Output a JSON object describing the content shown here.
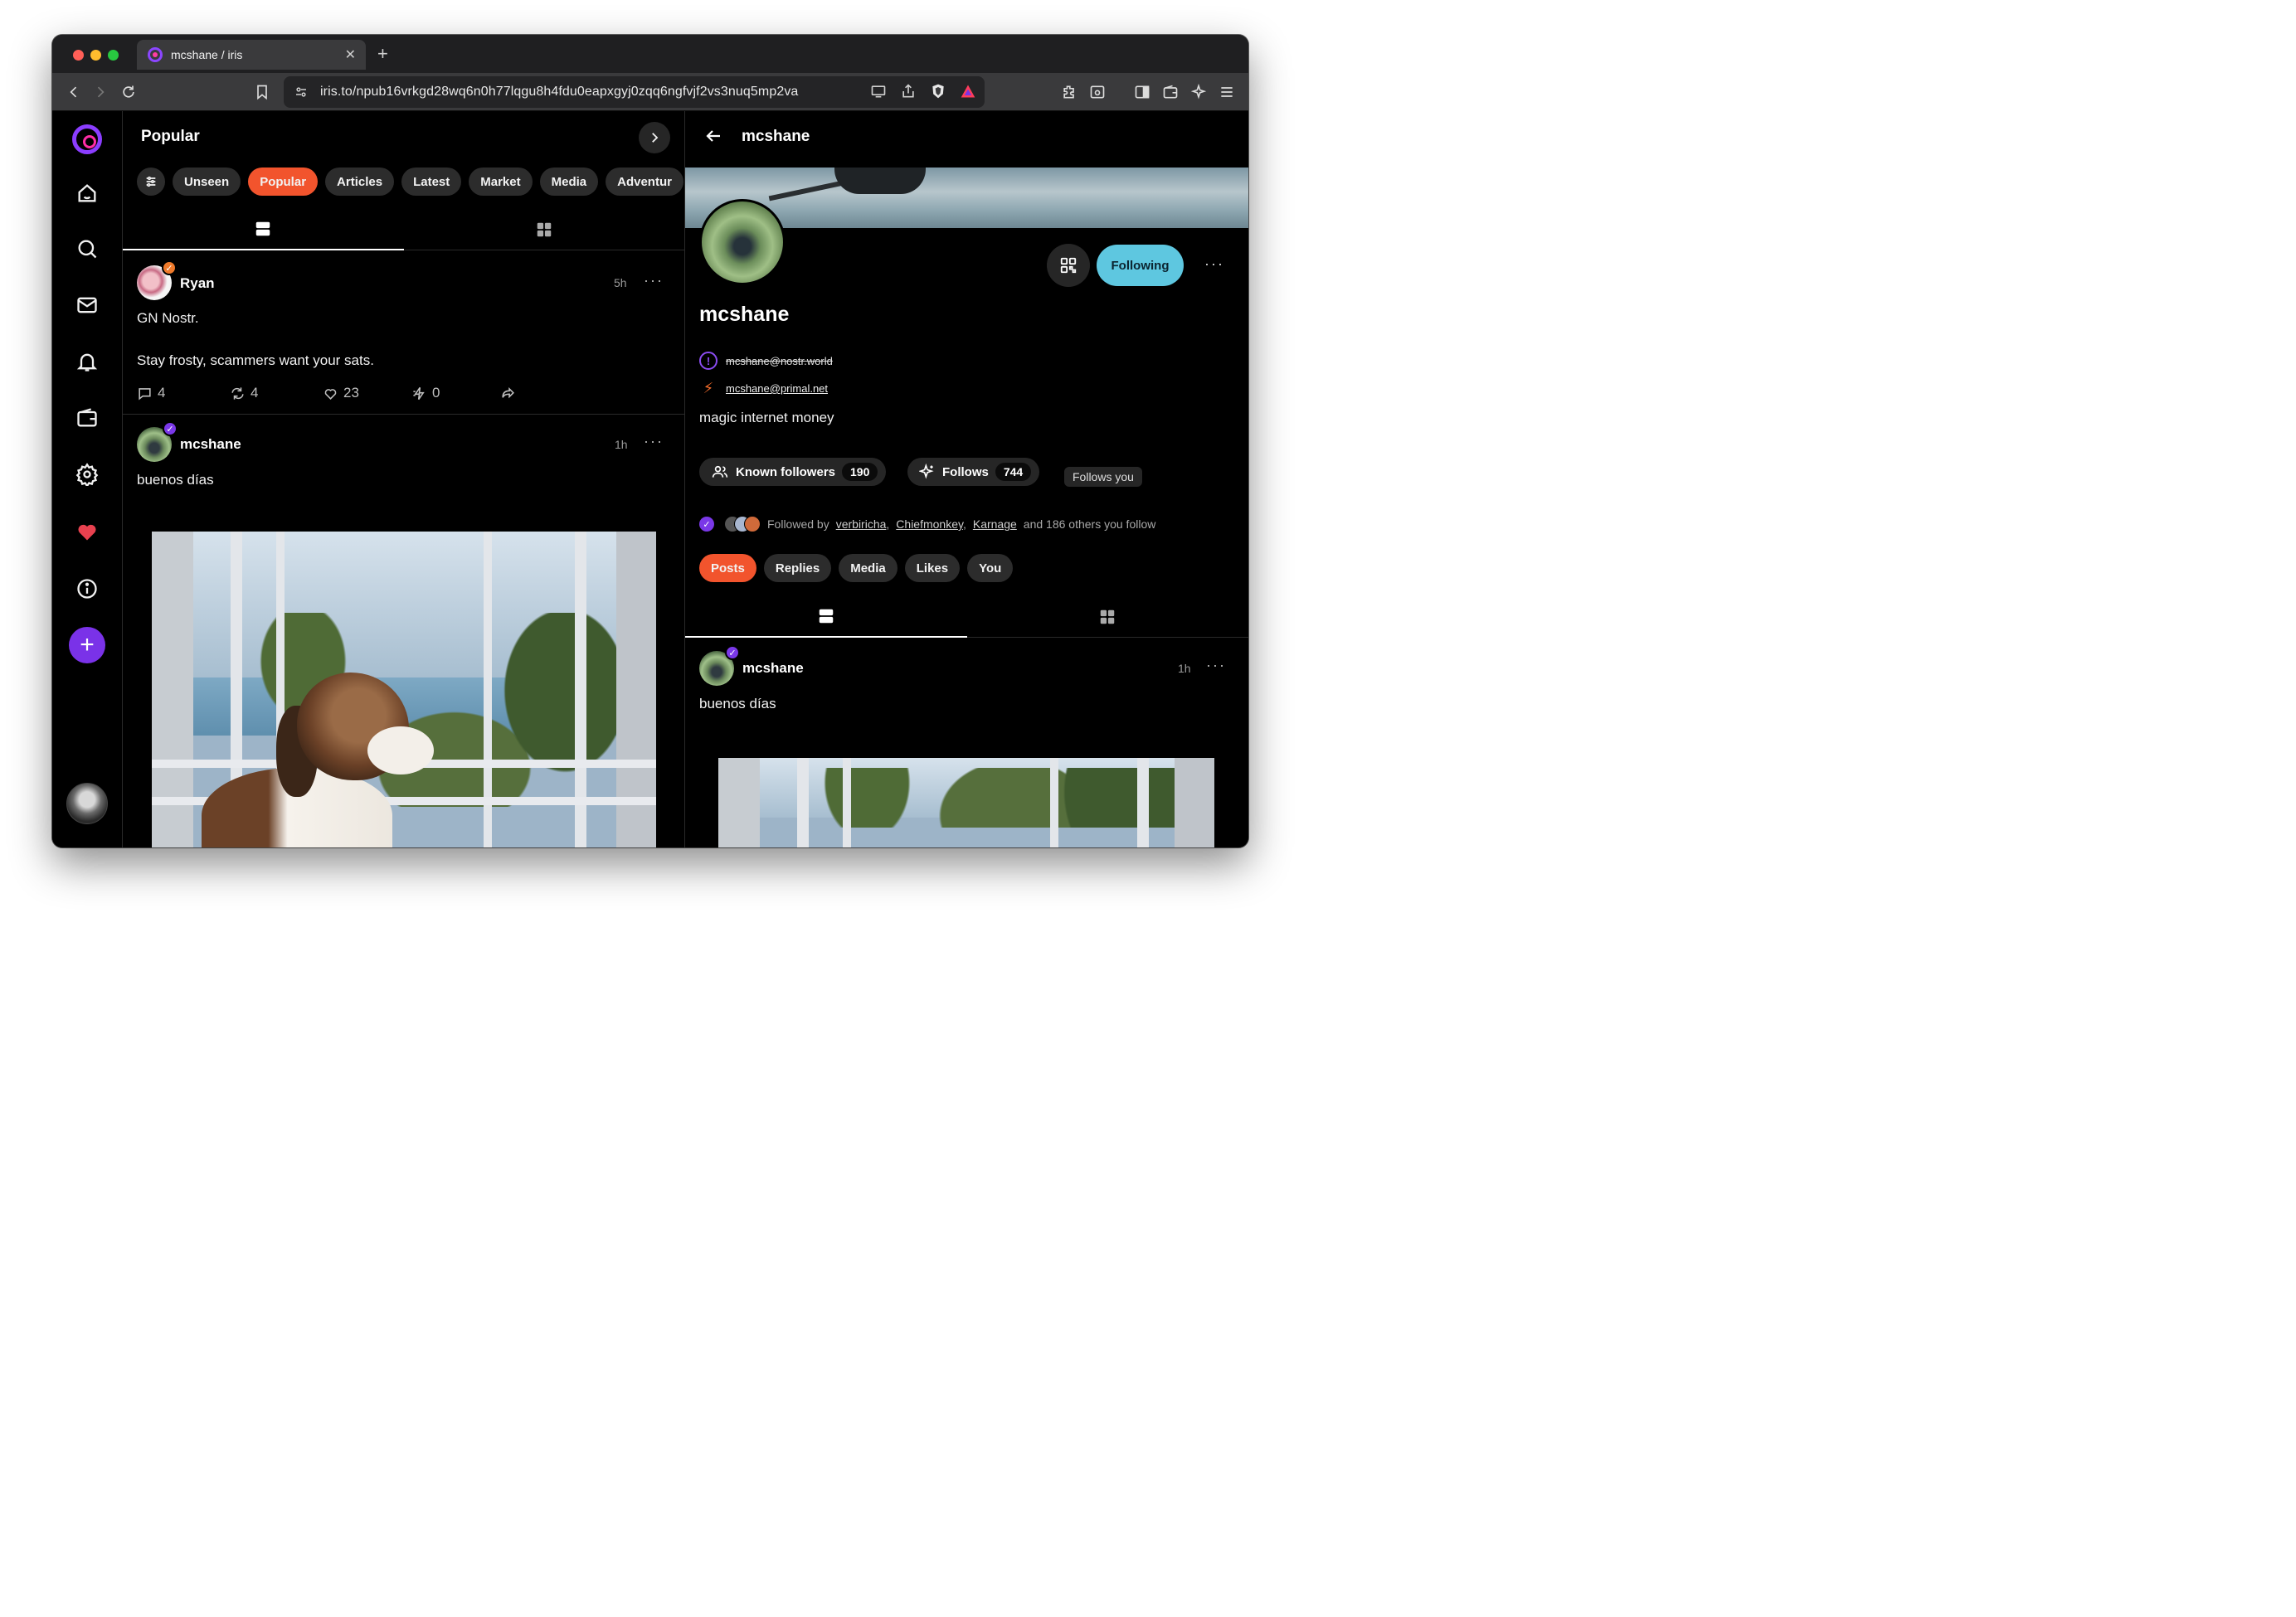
{
  "browser": {
    "tab_title": "mcshane / iris",
    "url": "iris.to/npub16vrkgd28wq6n0h77lqgu8h4fdu0eapxgyj0zqq6ngfvjf2vs3nuq5mp2va"
  },
  "feed": {
    "title": "Popular",
    "filters": [
      "Unseen",
      "Popular",
      "Articles",
      "Latest",
      "Market",
      "Media",
      "Adventur"
    ],
    "active_filter": "Popular",
    "posts": [
      {
        "author": "Ryan",
        "time": "5h",
        "text": "GN Nostr.\n\nStay frosty, scammers want your sats.",
        "replies": "4",
        "reposts": "4",
        "likes": "23",
        "zaps": "0"
      },
      {
        "author": "mcshane",
        "time": "1h",
        "text": "buenos días"
      }
    ]
  },
  "profile": {
    "header_name": "mcshane",
    "name": "mcshane",
    "following_label": "Following",
    "nip05_invalid": "mcshane@nostr.world",
    "lightning": "mcshane@primal.net",
    "bio": "magic internet money",
    "known_followers_label": "Known followers",
    "known_followers_count": "190",
    "follows_label": "Follows",
    "follows_count": "744",
    "follows_you": "Follows you",
    "followed_by_prefix": "Followed by",
    "followed_by_names": [
      "verbiricha",
      "Chiefmonkey",
      "Karnage"
    ],
    "followed_by_suffix": "and 186 others you follow",
    "tabs": [
      "Posts",
      "Replies",
      "Media",
      "Likes",
      "You"
    ],
    "active_tab": "Posts",
    "post": {
      "author": "mcshane",
      "time": "1h",
      "text": "buenos días"
    }
  },
  "colors": {
    "accent_orange": "#f2542d",
    "following_cyan": "#5ec7e0",
    "brand_purple": "#7a32e8"
  }
}
